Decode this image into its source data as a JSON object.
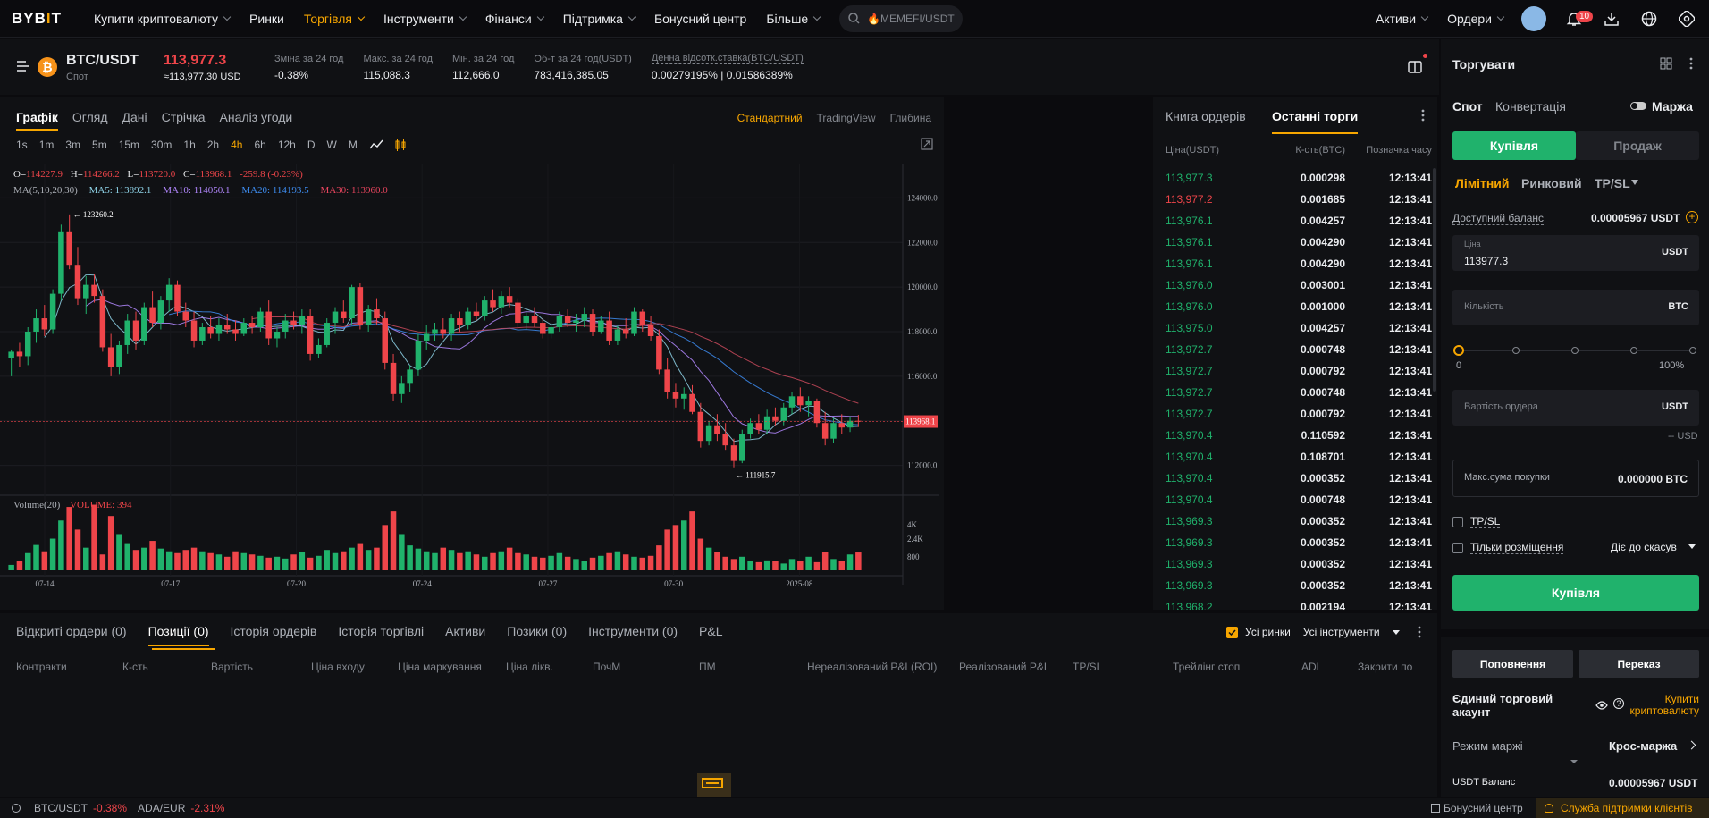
{
  "nav": {
    "logo": "BYBIT",
    "items": [
      "Купити криптовалюту",
      "Ринки",
      "Торгівля",
      "Інструменти",
      "Фінанси",
      "Підтримка",
      "Бонусний центр",
      "Більше"
    ],
    "search_placeholder": "🔥MEMEFI/USDT",
    "assets": "Активи",
    "orders": "Ордери",
    "notif_count": "10"
  },
  "ticker": {
    "pair": "BTC/USDT",
    "market": "Спот",
    "last_price": "113,977.3",
    "last_usd": "≈113,977.30 USD",
    "stats": [
      {
        "label": "Зміна за 24 год",
        "value": "-0.38%",
        "color": "red"
      },
      {
        "label": "Макс. за 24 год",
        "value": "115,088.3",
        "color": ""
      },
      {
        "label": "Мін. за 24 год",
        "value": "112,666.0",
        "color": ""
      },
      {
        "label": "Об-т за 24 год(USDT)",
        "value": "783,416,385.05",
        "color": ""
      },
      {
        "label": "Денна відсотк.ставка(BTC/USDT)",
        "value": "0.00279195% | 0.01586389%",
        "color": ""
      }
    ]
  },
  "chart": {
    "tabs": [
      "Графік",
      "Огляд",
      "Дані",
      "Стрічка",
      "Аналіз угоди"
    ],
    "modes": [
      "Стандартний",
      "TradingView",
      "Глибина"
    ],
    "intervals": [
      "1s",
      "1m",
      "3m",
      "5m",
      "15m",
      "30m",
      "1h",
      "2h",
      "4h",
      "6h",
      "12h",
      "D",
      "W",
      "M"
    ],
    "ohlc": {
      "o": "114227.9",
      "h": "114266.2",
      "l": "113720.0",
      "c": "113968.1",
      "chg": "-259.8 (-0.23%)"
    },
    "ma_label": "MA(5,10,20,30)",
    "ma5": "MA5: 113892.1",
    "ma10": "MA10: 114050.1",
    "ma20": "MA20: 114193.5",
    "ma30": "MA30: 113960.0",
    "high_mark": "123260.2",
    "low_mark": "111915.7",
    "last_tag": "113968.1",
    "volume_label": "Volume(20)",
    "volume_value": "VOLUME: 394",
    "y_ticks": [
      "124000.0",
      "122000.0",
      "120000.0",
      "118000.0",
      "116000.0",
      "114000.0",
      "112000.0"
    ],
    "vol_ticks": [
      "4K",
      "2.4K",
      "800"
    ],
    "x_ticks": [
      "07-14",
      "07-17",
      "07-20",
      "07-24",
      "07-27",
      "07-30",
      "2025-08"
    ]
  },
  "chart_data": {
    "type": "candlestick",
    "title": "BTC/USDT",
    "ylim": [
      110500,
      125500
    ],
    "candles": [
      [
        116800,
        117200,
        116000,
        117100
      ],
      [
        117100,
        117500,
        116400,
        116900
      ],
      [
        116900,
        118200,
        116500,
        118000
      ],
      [
        118000,
        119000,
        117500,
        118600
      ],
      [
        118600,
        119200,
        117800,
        118100
      ],
      [
        118100,
        119900,
        117900,
        119700
      ],
      [
        119700,
        122800,
        119400,
        122500
      ],
      [
        122500,
        123260,
        120800,
        121000
      ],
      [
        121000,
        121800,
        119200,
        119500
      ],
      [
        119500,
        120500,
        118800,
        120100
      ],
      [
        120100,
        120600,
        119300,
        119600
      ],
      [
        119600,
        119900,
        117100,
        117300
      ],
      [
        117300,
        117900,
        116000,
        116400
      ],
      [
        116400,
        117600,
        116100,
        117400
      ],
      [
        117400,
        118800,
        117000,
        118500
      ],
      [
        118500,
        118900,
        117200,
        117600
      ],
      [
        117600,
        119300,
        117400,
        119100
      ],
      [
        119100,
        119800,
        118200,
        118400
      ],
      [
        118400,
        119600,
        118100,
        119400
      ],
      [
        119400,
        120400,
        118900,
        120100
      ],
      [
        120100,
        120300,
        118700,
        118900
      ],
      [
        118900,
        119300,
        118200,
        118500
      ],
      [
        118500,
        118900,
        117300,
        117600
      ],
      [
        117600,
        118400,
        117400,
        118200
      ],
      [
        118200,
        118700,
        117700,
        117900
      ],
      [
        117900,
        118600,
        117600,
        118300
      ],
      [
        118300,
        118800,
        117900,
        118100
      ],
      [
        118100,
        118500,
        117600,
        117900
      ],
      [
        117900,
        118600,
        117800,
        118400
      ],
      [
        118400,
        118700,
        117900,
        118200
      ],
      [
        118200,
        119100,
        118000,
        118900
      ],
      [
        118900,
        119400,
        117400,
        117700
      ],
      [
        117700,
        118200,
        117300,
        118000
      ],
      [
        118000,
        118800,
        117700,
        118500
      ],
      [
        118500,
        118900,
        118100,
        118300
      ],
      [
        118300,
        119000,
        117900,
        118700
      ],
      [
        118700,
        119000,
        116700,
        117000
      ],
      [
        117000,
        117700,
        116800,
        117400
      ],
      [
        117400,
        118600,
        117300,
        118400
      ],
      [
        118400,
        119100,
        117900,
        118900
      ],
      [
        118900,
        119400,
        118400,
        118600
      ],
      [
        118600,
        120100,
        118300,
        120000
      ],
      [
        120000,
        120200,
        118100,
        118300
      ],
      [
        118300,
        119200,
        118000,
        119000
      ],
      [
        119000,
        119500,
        118300,
        118600
      ],
      [
        118600,
        118900,
        116300,
        116600
      ],
      [
        116600,
        117000,
        114900,
        115200
      ],
      [
        115200,
        116000,
        114800,
        115700
      ],
      [
        115700,
        116500,
        115300,
        116300
      ],
      [
        116300,
        117900,
        116000,
        117600
      ],
      [
        117600,
        118300,
        117200,
        117900
      ],
      [
        117900,
        118400,
        117600,
        118100
      ],
      [
        118100,
        118600,
        117700,
        117900
      ],
      [
        117900,
        118800,
        117600,
        118600
      ],
      [
        118600,
        118900,
        118000,
        118300
      ],
      [
        118300,
        119100,
        118100,
        118900
      ],
      [
        118900,
        119300,
        118500,
        118700
      ],
      [
        118700,
        119600,
        118500,
        119400
      ],
      [
        119400,
        119900,
        118900,
        119100
      ],
      [
        119100,
        119800,
        118800,
        119600
      ],
      [
        119600,
        120000,
        119100,
        119300
      ],
      [
        119300,
        119500,
        118200,
        118400
      ],
      [
        118400,
        118900,
        118100,
        118700
      ],
      [
        118700,
        119100,
        118200,
        118400
      ],
      [
        118400,
        118600,
        117700,
        117900
      ],
      [
        117900,
        118400,
        117700,
        118200
      ],
      [
        118200,
        118900,
        118000,
        118700
      ],
      [
        118700,
        119000,
        118200,
        118400
      ],
      [
        118400,
        118800,
        118000,
        118500
      ],
      [
        118500,
        119100,
        118200,
        118800
      ],
      [
        118800,
        119000,
        117800,
        118000
      ],
      [
        118000,
        118700,
        117900,
        118500
      ],
      [
        118500,
        118900,
        117400,
        117600
      ],
      [
        117600,
        118300,
        117400,
        118100
      ],
      [
        118100,
        118600,
        117700,
        117900
      ],
      [
        117900,
        119100,
        117800,
        118900
      ],
      [
        118900,
        119000,
        118000,
        118300
      ],
      [
        118300,
        118700,
        117600,
        117800
      ],
      [
        117800,
        118100,
        116100,
        116300
      ],
      [
        116300,
        116800,
        115000,
        115300
      ],
      [
        115300,
        115700,
        114600,
        115000
      ],
      [
        115000,
        115500,
        114500,
        115200
      ],
      [
        115200,
        115600,
        114300,
        114400
      ],
      [
        114400,
        114800,
        112800,
        113100
      ],
      [
        113100,
        114000,
        112900,
        113800
      ],
      [
        113800,
        114300,
        113100,
        113400
      ],
      [
        113400,
        113900,
        112700,
        112900
      ],
      [
        112900,
        113200,
        111915,
        112200
      ],
      [
        112200,
        113600,
        112100,
        113400
      ],
      [
        113400,
        114100,
        113200,
        113900
      ],
      [
        113900,
        114300,
        113400,
        113600
      ],
      [
        113600,
        114500,
        113400,
        114200
      ],
      [
        114200,
        114600,
        113800,
        114000
      ],
      [
        114000,
        114800,
        113800,
        114600
      ],
      [
        114600,
        115300,
        114300,
        115100
      ],
      [
        115100,
        115500,
        114400,
        114700
      ],
      [
        114700,
        115100,
        114200,
        114900
      ],
      [
        114900,
        115000,
        113700,
        113900
      ],
      [
        113900,
        114400,
        112900,
        113200
      ],
      [
        113200,
        114100,
        113000,
        113900
      ],
      [
        113900,
        114300,
        113400,
        113700
      ],
      [
        113700,
        114200,
        113500,
        114000
      ],
      [
        114000,
        114266,
        113720,
        113968
      ]
    ],
    "volume": [
      120,
      200,
      380,
      560,
      420,
      700,
      1100,
      1400,
      900,
      500,
      1450,
      350,
      1200,
      800,
      600,
      450,
      500,
      650,
      480,
      420,
      380,
      450,
      500,
      420,
      380,
      350,
      300,
      420,
      380,
      350,
      320,
      280,
      300,
      260,
      350,
      400,
      280,
      320,
      450,
      380,
      420,
      500,
      600,
      450,
      500,
      1000,
      1300,
      800,
      550,
      480,
      420,
      380,
      500,
      450,
      380,
      420,
      350,
      300,
      380,
      420,
      500,
      380,
      350,
      300,
      280,
      320,
      380,
      300,
      250,
      200,
      280,
      320,
      380,
      420,
      350,
      300,
      280,
      320,
      550,
      900,
      1000,
      1100,
      1300,
      700,
      500,
      400,
      300,
      250,
      300,
      200,
      180,
      220,
      200,
      150,
      250,
      200,
      300,
      180,
      400,
      250,
      200,
      350,
      394
    ]
  },
  "orderbook": {
    "tabs": [
      "Книга ордерів",
      "Останні торги"
    ],
    "cols": [
      "Ціна(USDT)",
      "К-сть(BTC)",
      "Позначка часу"
    ],
    "rows": [
      [
        "113,977.3",
        "0.000298",
        "12:13:41",
        "g"
      ],
      [
        "113,977.2",
        "0.001685",
        "12:13:41",
        "r"
      ],
      [
        "113,976.1",
        "0.004257",
        "12:13:41",
        "g"
      ],
      [
        "113,976.1",
        "0.004290",
        "12:13:41",
        "g"
      ],
      [
        "113,976.1",
        "0.004290",
        "12:13:41",
        "g"
      ],
      [
        "113,976.0",
        "0.003001",
        "12:13:41",
        "g"
      ],
      [
        "113,976.0",
        "0.001000",
        "12:13:41",
        "g"
      ],
      [
        "113,975.0",
        "0.004257",
        "12:13:41",
        "g"
      ],
      [
        "113,972.7",
        "0.000748",
        "12:13:41",
        "g"
      ],
      [
        "113,972.7",
        "0.000792",
        "12:13:41",
        "g"
      ],
      [
        "113,972.7",
        "0.000748",
        "12:13:41",
        "g"
      ],
      [
        "113,972.7",
        "0.000792",
        "12:13:41",
        "g"
      ],
      [
        "113,970.4",
        "0.110592",
        "12:13:41",
        "g"
      ],
      [
        "113,970.4",
        "0.108701",
        "12:13:41",
        "g"
      ],
      [
        "113,970.4",
        "0.000352",
        "12:13:41",
        "g"
      ],
      [
        "113,970.4",
        "0.000748",
        "12:13:41",
        "g"
      ],
      [
        "113,969.3",
        "0.000352",
        "12:13:41",
        "g"
      ],
      [
        "113,969.3",
        "0.000352",
        "12:13:41",
        "g"
      ],
      [
        "113,969.3",
        "0.000352",
        "12:13:41",
        "g"
      ],
      [
        "113,969.3",
        "0.000352",
        "12:13:41",
        "g"
      ],
      [
        "113,968.2",
        "0.002194",
        "12:13:41",
        "g"
      ]
    ]
  },
  "trade": {
    "title": "Торгувати",
    "tabs": [
      "Спот",
      "Конвертація"
    ],
    "margin": "Маржа",
    "buy": "Купівля",
    "sell": "Продаж",
    "order_types": [
      "Лімітний",
      "Ринковий",
      "TP/SL"
    ],
    "balance_label": "Доступний баланс",
    "balance_value": "0.00005967 USDT",
    "price_label": "Ціна",
    "price_value": "113977.3",
    "unit_usdt": "USDT",
    "qty_placeholder": "Кількість",
    "unit_btc": "BTC",
    "slider_min": "0",
    "slider_max": "100%",
    "order_value_placeholder": "Вартість ордера",
    "usd_hint": "-- USD",
    "max_buy_label": "Макс.сума покупки",
    "max_buy_value": "0.000000 BTC",
    "tpsl": "TP/SL",
    "post_only": "Тільки розміщення",
    "tif": "Діє до скасув",
    "submit": "Купівля",
    "deposit": "Поповнення",
    "transfer": "Переказ",
    "account_title": "Єдиний торговий акаунт",
    "buy_crypto": "Купити криптовалюту",
    "margin_mode_label": "Режим маржі",
    "margin_mode_value": "Крос-маржа",
    "usdt_balance_label": "USDT Баланс",
    "usdt_balance_value": "0.00005967 USDT"
  },
  "positions": {
    "tabs": [
      "Відкриті ордери (0)",
      "Позиції (0)",
      "Історія ордерів",
      "Історія торгівлі",
      "Активи",
      "Позики (0)",
      "Інструменти (0)",
      "P&L"
    ],
    "all_markets": "Усі ринки",
    "all_instruments": "Усі інструменти",
    "cols": [
      "Контракти",
      "К-сть",
      "Вартість",
      "Ціна входу",
      "Ціна маркування",
      "Ціна лікв.",
      "ПочМ",
      "ПМ",
      "Нереалізований P&L(ROI)",
      "Реалізований P&L",
      "TP/SL",
      "Трейлінг стоп",
      "ADL",
      "Закрити по"
    ]
  },
  "status": {
    "items": [
      {
        "pair": "BTC/USDT",
        "chg": "-0.38%"
      },
      {
        "pair": "ADA/EUR",
        "chg": "-2.31%"
      }
    ],
    "bonus": "Бонусний центр",
    "support": "Служба підтримки клієнтів"
  }
}
